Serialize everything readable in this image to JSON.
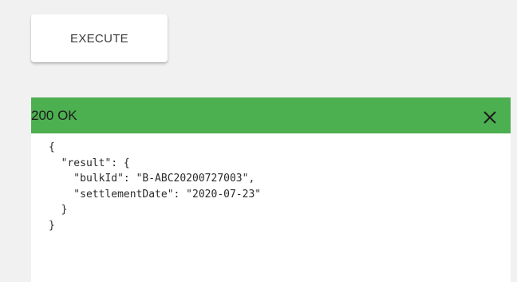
{
  "execute_button": {
    "label": "EXECUTE"
  },
  "response": {
    "status": "200 OK",
    "header_color": "#4caf50",
    "close_icon": "close-icon",
    "lines": [
      "{",
      "  \"result\": {",
      "    \"bulkId\": \"B-ABC20200727003\",",
      "    \"settlementDate\": \"2020-07-23\"",
      "  }",
      "}"
    ]
  }
}
